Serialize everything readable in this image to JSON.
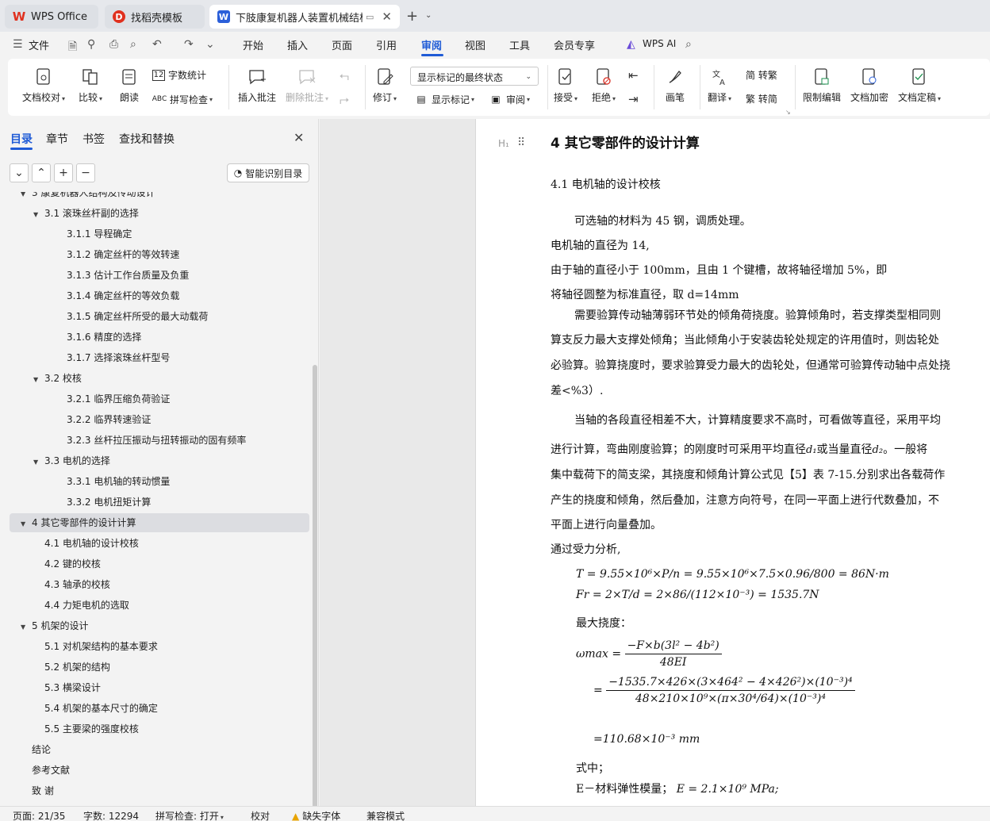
{
  "tabs": [
    {
      "label": "WPS Office"
    },
    {
      "label": "找稻壳模板"
    },
    {
      "label": "下肢康复机器人装置机械结构设计"
    }
  ],
  "menu": {
    "file": "文件",
    "items": [
      "开始",
      "插入",
      "页面",
      "引用",
      "审阅",
      "视图",
      "工具",
      "会员专享"
    ],
    "ai": "WPS AI"
  },
  "ribbon": {
    "doc_check": "文档校对",
    "compare": "比较",
    "read_aloud": "朗读",
    "word_count": "字数统计",
    "spell_check": "拼写检查",
    "insert_comment": "插入批注",
    "delete_comment": "删除批注",
    "revise": "修订",
    "markup_state": "显示标记的最终状态",
    "show_markup": "显示标记",
    "review": "审阅",
    "accept": "接受",
    "reject": "拒绝",
    "pen": "画笔",
    "translate": "翻译",
    "to_traditional": "简 转繁",
    "to_simplified": "繁 转简",
    "restrict_edit": "限制编辑",
    "encrypt": "文档加密",
    "finalize": "文档定稿"
  },
  "left_panel": {
    "tabs": [
      "目录",
      "章节",
      "书签",
      "查找和替换"
    ],
    "smart_toc": "智能识别目录",
    "toc": [
      {
        "label": "3   康复机器人结构及传动设计",
        "level": 0,
        "expand": "▼"
      },
      {
        "label": "3.1  滚珠丝杆副的选择",
        "level": 1,
        "expand": "▼"
      },
      {
        "label": "3.1.1 导程确定",
        "level": 2,
        "expand": ""
      },
      {
        "label": "3.1.2 确定丝杆的等效转速",
        "level": 2,
        "expand": ""
      },
      {
        "label": "3.1.3 估计工作台质量及负重",
        "level": 2,
        "expand": ""
      },
      {
        "label": "3.1.4 确定丝杆的等效负载",
        "level": 2,
        "expand": ""
      },
      {
        "label": "3.1.5 确定丝杆所受的最大动载荷",
        "level": 2,
        "expand": ""
      },
      {
        "label": "3.1.6 精度的选择",
        "level": 2,
        "expand": ""
      },
      {
        "label": "3.1.7 选择滚珠丝杆型号",
        "level": 2,
        "expand": ""
      },
      {
        "label": "3.2 校核",
        "level": 1,
        "expand": "▼"
      },
      {
        "label": "3.2.1  临界压缩负荷验证",
        "level": 2,
        "expand": ""
      },
      {
        "label": "3.2.2 临界转速验证",
        "level": 2,
        "expand": ""
      },
      {
        "label": "3.2.3 丝杆拉压振动与扭转振动的固有频率",
        "level": 2,
        "expand": ""
      },
      {
        "label": "3.3 电机的选择",
        "level": 1,
        "expand": "▼"
      },
      {
        "label": "3.3.1 电机轴的转动惯量",
        "level": 2,
        "expand": ""
      },
      {
        "label": "3.3.2 电机扭矩计算",
        "level": 2,
        "expand": ""
      },
      {
        "label": "4   其它零部件的设计计算",
        "level": 0,
        "expand": "▼"
      },
      {
        "label": "4.1 电机轴的设计校核",
        "level": 1,
        "expand": ""
      },
      {
        "label": "4.2 键的校核",
        "level": 1,
        "expand": ""
      },
      {
        "label": "4.3 轴承的校核",
        "level": 1,
        "expand": ""
      },
      {
        "label": "4.4 力矩电机的选取",
        "level": 1,
        "expand": ""
      },
      {
        "label": "5  机架的设计",
        "level": 0,
        "expand": "▼"
      },
      {
        "label": "5.1 对机架结构的基本要求",
        "level": 1,
        "expand": ""
      },
      {
        "label": "5.2 机架的结构",
        "level": 1,
        "expand": ""
      },
      {
        "label": "5.3 横梁设计",
        "level": 1,
        "expand": ""
      },
      {
        "label": "5.4 机架的基本尺寸的确定",
        "level": 1,
        "expand": ""
      },
      {
        "label": "5.5 主要梁的强度校核",
        "level": 1,
        "expand": ""
      },
      {
        "label": "结论",
        "level": 0,
        "expand": ""
      },
      {
        "label": "参考文献",
        "level": 0,
        "expand": ""
      },
      {
        "label": "致  谢",
        "level": 0,
        "expand": ""
      }
    ]
  },
  "document": {
    "heading_mark": "H₁",
    "title": "4   其它零部件的设计计算",
    "subtitle": "4.1 电机轴的设计校核",
    "lines": [
      "可选轴的材料为 45 钢，调质处理。",
      "电机轴的直径为 14,",
      "由于轴的直径小于 100mm，且由 1 个键槽，故将轴径增加 5%，即",
      "将轴径圆整为标准直径，取 d=14mm",
      "需要验算传动轴薄弱环节处的倾角荷挠度。验算倾角时，若支撑类型相同则",
      "算支反力最大支撑处倾角；当此倾角小于安装齿轮处规定的许用值时，则齿轮处",
      "必验算。验算挠度时，要求验算受力最大的齿轮处，但通常可验算传动轴中点处挠",
      "差<%3）.",
      "当轴的各段直径相差不大，计算精度要求不高时，可看做等直径，采用平均",
      "进行计算，弯曲刚度验算；的刚度时可采用平均直径",
      "或当量直径",
      "。一般将",
      "集中载荷下的简支梁，其挠度和倾角计算公式见【5】表 7-15.分别求出各载荷作",
      "产生的挠度和倾角，然后叠加，注意方向符号，在同一平面上进行代数叠加，不",
      "平面上进行向量叠加。",
      "通过受力分析,",
      "最大挠度：",
      "式中；",
      "E－材料弹性模量；"
    ],
    "formulas": {
      "torque": "T = 9.55×10⁶×P/n = 9.55×10⁶×7.5×0.96/800 = 86N·m",
      "force": "Fr = 2×T/d = 2×86/(112×10⁻³) = 1535.7N",
      "omega_lhs": "ωmax =",
      "omega_num": "−F×b(3l² − 4b²)",
      "omega_den": "48EI",
      "eq2_num": "−1535.7×426×(3×464² − 4×426²)×(10⁻³)⁴",
      "eq2_den": "48×210×10⁹×(π×30⁴/64)×(10⁻³)⁴",
      "result": "=110.68×10⁻³ mm",
      "modulus": "E = 2.1×10⁹ MPa;",
      "d1": "d₁",
      "d2": "d₂"
    }
  },
  "status": {
    "page": "页面: 21/35",
    "words": "字数: 12294",
    "spell": "拼写检查: 打开",
    "proof": "校对",
    "missing_font": "缺失字体",
    "compat": "兼容模式"
  },
  "colors": {
    "accent": "#1f5bd6",
    "wps_red": "#e0301e",
    "doc_blue": "#2b5fd9"
  }
}
